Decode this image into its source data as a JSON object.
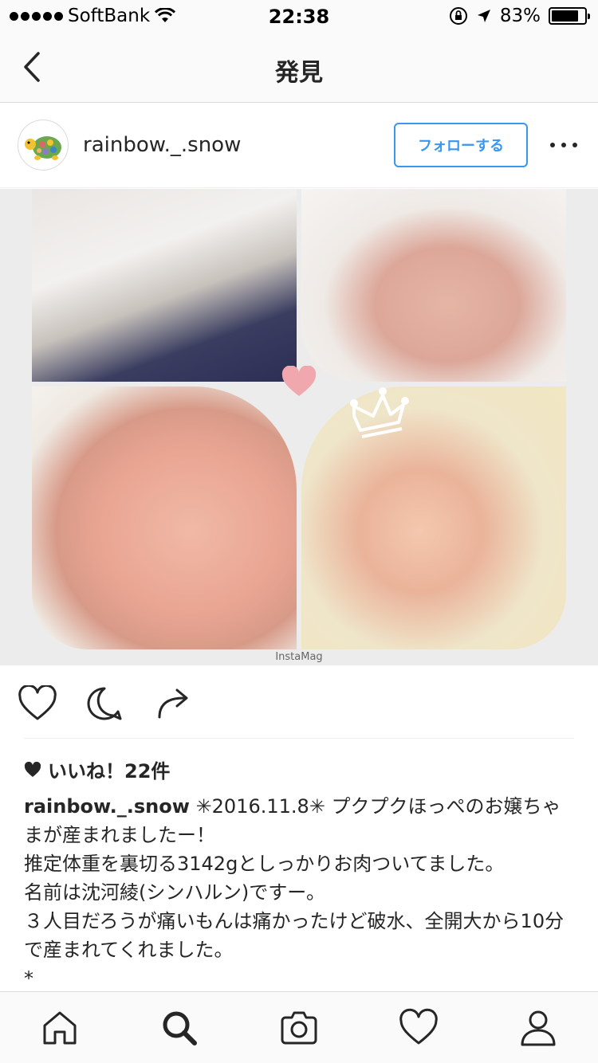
{
  "status_bar": {
    "carrier": "SoftBank",
    "time": "22:38",
    "battery_percent": "83%",
    "battery_level": 0.83
  },
  "nav": {
    "title": "発見",
    "back_icon": "chevron-left-icon"
  },
  "post": {
    "username": "rainbow._.snow",
    "follow_label": "フォローする",
    "more_icon": "more-horizontal-icon",
    "photo_watermark": "InstaMag",
    "actions": [
      "heart-icon",
      "comment-icon",
      "share-icon"
    ],
    "likes_label": "いいね！22件",
    "caption_user": "rainbow._.snow",
    "caption_text": " ✳2016.11.8✳ プクプクほっぺのお嬢ちゃまが産まれましたー！\n推定体重を裏切る3142gとしっかりお肉ついてました。\n名前は沈河綾(シンハルン)ですー。\n３人目だろうが痛いもんは痛かったけど破水、全開大から10分で産まれてくれました。\n*"
  },
  "tab_bar": {
    "items": [
      "home-icon",
      "search-icon",
      "camera-icon",
      "activity-heart-icon",
      "profile-icon"
    ],
    "active": "search-icon"
  },
  "colors": {
    "accent": "#3897f0",
    "text": "#262626",
    "border": "#dbdbdb",
    "bar_bg": "#fafafa",
    "deco_heart": "#f0a7ad"
  }
}
